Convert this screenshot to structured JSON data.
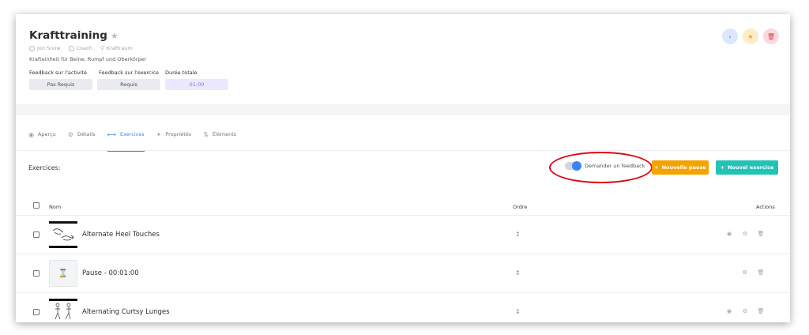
{
  "header": {
    "title": "Krafttraining",
    "meta": {
      "author": "Jon Snow",
      "role": "Coach",
      "location": "Kraftraum"
    },
    "description": "Krafteinheit für Beine, Rumpf und Oberkörper",
    "fields": {
      "activity_feedback_label": "Feedback sur l'activité",
      "activity_feedback_value": "Pas Requis",
      "exercise_feedback_label": "Feedback sur l'exercice",
      "exercise_feedback_value": "Requis",
      "duration_label": "Durée totale",
      "duration_value": "01:00"
    }
  },
  "tabs": [
    {
      "label": "Aperçu",
      "icon": "eye-icon"
    },
    {
      "label": "Détails",
      "icon": "gear-icon"
    },
    {
      "label": "Exercices",
      "icon": "dumbbell-icon",
      "active": true
    },
    {
      "label": "Propriétés",
      "icon": "pin-icon"
    },
    {
      "label": "Éléments",
      "icon": "sort-icon"
    }
  ],
  "exercises": {
    "title": "Exercices:",
    "toggle_label": "Demander un feedback",
    "toggle_on": true,
    "new_pause_label": "Nouvelle pause",
    "new_exercise_label": "Nouvel exercice",
    "columns": {
      "name": "Nom",
      "order": "Ordre",
      "actions": "Actions"
    },
    "rows": [
      {
        "name": "Alternate Heel Touches",
        "type": "exercise",
        "thumbnail": "heel-touches-illustration"
      },
      {
        "name": "Pause - 00:01:00",
        "type": "pause",
        "thumbnail": "hourglass-icon"
      },
      {
        "name": "Alternating Curtsy Lunges",
        "type": "exercise",
        "thumbnail": "curtsy-lunges-illustration"
      }
    ]
  },
  "colors": {
    "primary": "#3b82f6",
    "warning": "#f5a300",
    "teal": "#22c3b6",
    "danger": "#e63946",
    "annotation": "#e00016"
  }
}
